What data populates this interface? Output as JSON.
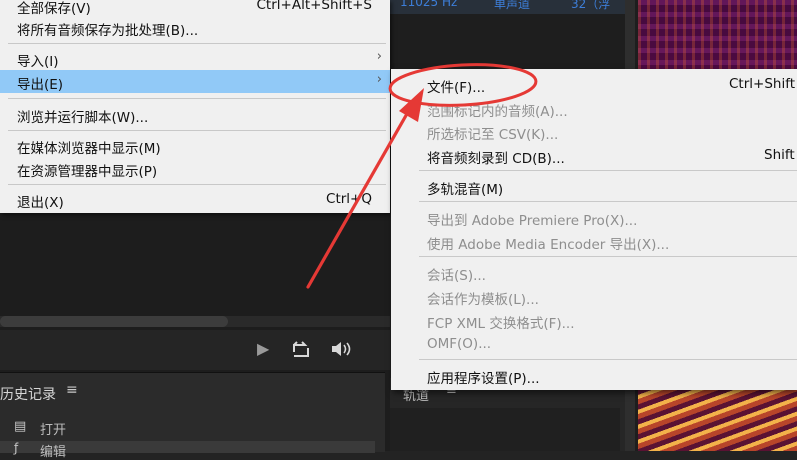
{
  "background": {
    "files_row": {
      "sample_rate": "11025 Hz",
      "channel": "单声道",
      "bit": "32（浮"
    },
    "history_panel": {
      "title": "历史记录",
      "menu_glyph": "≡",
      "rows": [
        "打开",
        "编辑"
      ]
    },
    "tracks_panel": {
      "title": "轨道",
      "menu_glyph": "≡"
    },
    "transport_icons": [
      "play-icon",
      "loop-icon",
      "volume-icon"
    ]
  },
  "main_menu": {
    "items": [
      {
        "label": "全部保存(V)",
        "shortcut": "Ctrl+Alt+Shift+S"
      },
      {
        "label": "将所有音频保存为批处理(B)..."
      },
      {
        "label": "导入(I)",
        "arrow": "›"
      },
      {
        "label": "导出(E)",
        "arrow": "›",
        "highlighted": true
      },
      {
        "label": "浏览并运行脚本(W)..."
      },
      {
        "label": "在媒体浏览器中显示(M)"
      },
      {
        "label": "在资源管理器中显示(P)"
      },
      {
        "label": "退出(X)",
        "shortcut": "Ctrl+Q"
      }
    ]
  },
  "export_submenu": {
    "items": [
      {
        "label": "文件(F)...",
        "shortcut": "Ctrl+Shift",
        "enabled": true
      },
      {
        "label": "范围标记内的音频(A)...",
        "enabled": false
      },
      {
        "label": "所选标记至 CSV(K)...",
        "enabled": false
      },
      {
        "label": "将音频刻录到 CD(B)...",
        "shortcut": "Shift",
        "enabled": true
      },
      {
        "label": "多轨混音(M)",
        "enabled": true
      },
      {
        "label": "导出到 Adobe Premiere Pro(X)...",
        "enabled": false
      },
      {
        "label": "使用 Adobe Media Encoder 导出(X)...",
        "enabled": false
      },
      {
        "label": "会话(S)...",
        "enabled": false
      },
      {
        "label": "会话作为模板(L)...",
        "enabled": false
      },
      {
        "label": "FCP XML 交换格式(F)...",
        "enabled": false
      },
      {
        "label": "OMF(O)...",
        "enabled": false
      },
      {
        "label": "应用程序设置(P)...",
        "enabled": true
      }
    ]
  },
  "annotation": {
    "color": "#e53935"
  },
  "colors": {
    "highlight": "#91c9f7",
    "menu_bg": "#f0f0f0",
    "disabled_text": "#8e8e8e",
    "accent_blue": "#3d7ed8"
  }
}
